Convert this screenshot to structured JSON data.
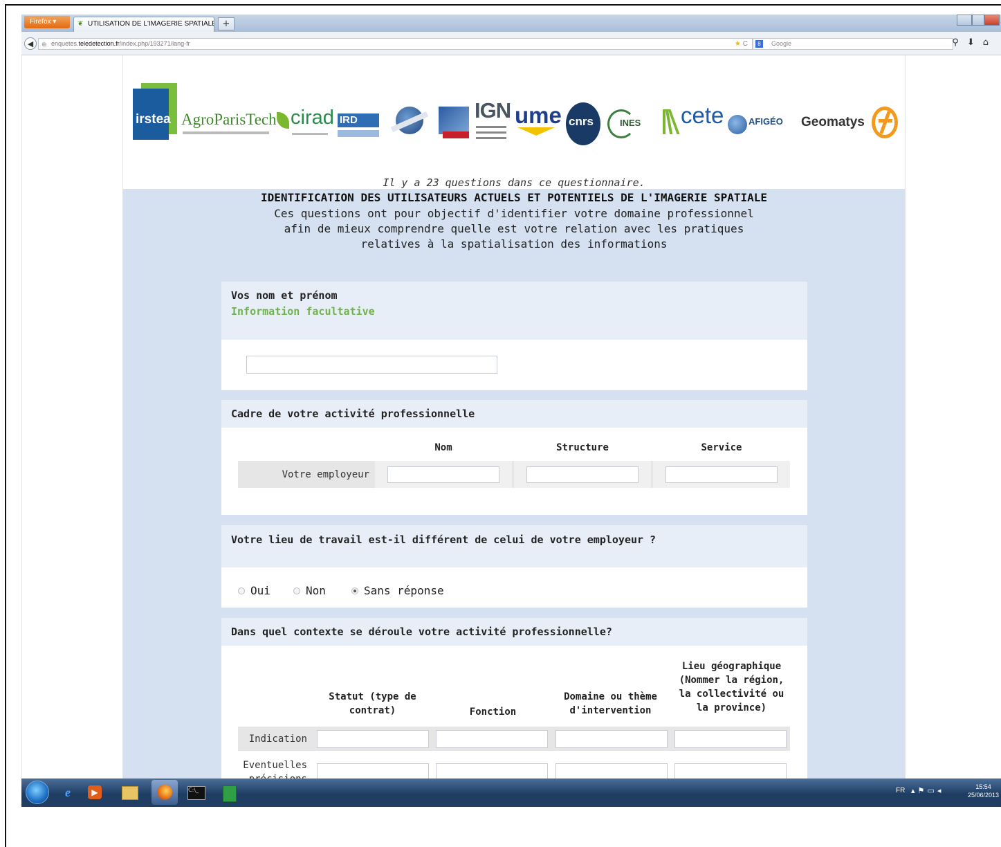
{
  "browser": {
    "menu_button": "Firefox",
    "tab_title": "UTILISATION DE L'IMAGERIE SPATIALE ...",
    "new_tab": "+",
    "url_prefix": "enquetes.",
    "url_domain": "teledetection.fr",
    "url_path": "/index.php/193271/lang-fr",
    "search_placeholder": "Google"
  },
  "logos": [
    "irstea",
    "AgroParisTech",
    "cirad",
    "IRD",
    "IGN",
    "ume",
    "cnrs",
    "INES",
    "cete",
    "AFIGÉO",
    "Geomatys"
  ],
  "survey": {
    "question_count": "Il y a 23 questions dans ce questionnaire.",
    "title": "IDENTIFICATION DES UTILISATEURS ACTUELS ET POTENTIELS DE L'IMAGERIE SPATIALE",
    "description": [
      "Ces questions ont pour objectif d'identifier votre domaine professionnel",
      "afin de mieux comprendre quelle est votre relation avec les pratiques",
      "relatives à la spatialisation des informations"
    ]
  },
  "questions": {
    "q1": {
      "title": "Vos nom et prénom",
      "help": "Information facultative",
      "value": ""
    },
    "q2": {
      "title": "Cadre de votre activité professionnelle",
      "columns": [
        "Nom",
        "Structure",
        "Service"
      ],
      "row_label": "Votre employeur"
    },
    "q3": {
      "title": "Votre lieu de travail est-il différent de celui de votre employeur ?",
      "options": [
        "Oui",
        "Non",
        "Sans réponse"
      ],
      "selected": "Sans réponse"
    },
    "q4": {
      "title": "Dans quel contexte se déroule votre activité professionnelle?",
      "columns": [
        "Statut (type de contrat)",
        "Fonction",
        "Domaine ou thème d'intervention",
        "Lieu géographique (Nommer la région, la collectivité ou la province)"
      ],
      "rows": [
        "Indication",
        "Eventuelles précisions"
      ]
    }
  },
  "taskbar": {
    "lang": "FR",
    "time": "15:54",
    "date": "25/06/2013"
  }
}
